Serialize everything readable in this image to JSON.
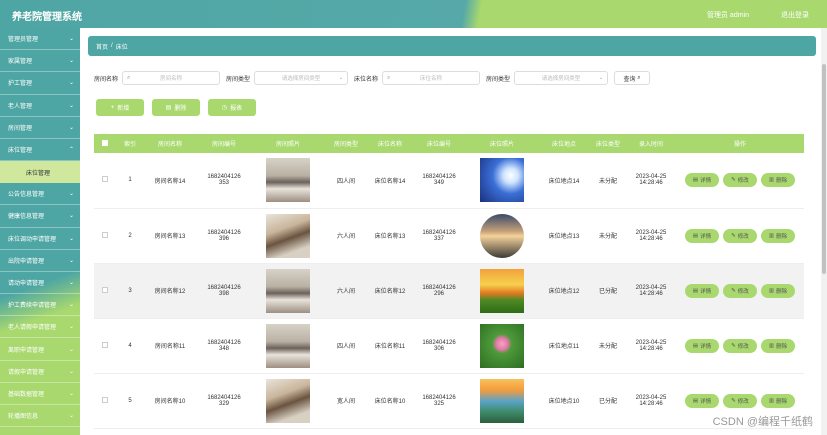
{
  "header": {
    "title": "养老院管理系统",
    "user": "管理员 admin",
    "logout": "退出登录"
  },
  "sidebar": {
    "items": [
      {
        "label": "管理员管理"
      },
      {
        "label": "家属管理"
      },
      {
        "label": "护工管理"
      },
      {
        "label": "老人管理"
      },
      {
        "label": "房间管理"
      },
      {
        "label": "床位管理"
      }
    ],
    "sub": {
      "label": "床位管理"
    },
    "items2": [
      {
        "label": "公告信息管理"
      },
      {
        "label": "健康信息管理"
      },
      {
        "label": "床位调动申请管理"
      },
      {
        "label": "出院申请管理"
      },
      {
        "label": "请动申请管理"
      },
      {
        "label": "护工费续申请管理"
      },
      {
        "label": "老人请假申请管理"
      },
      {
        "label": "离职申请管理"
      },
      {
        "label": "请假申请管理"
      },
      {
        "label": "基础数据管理"
      },
      {
        "label": "轮播图信息"
      }
    ]
  },
  "breadcrumb": {
    "home": "首页",
    "current": "床位"
  },
  "search": {
    "room_name_label": "房间名称",
    "room_name_placeholder": "房间名称",
    "room_type_label": "房间类型",
    "room_type_placeholder": "请选择房间类型",
    "bed_name_label": "床位名称",
    "bed_name_placeholder": "床位名称",
    "bed_type_label": "房间类型",
    "bed_type_placeholder": "请选择房间类型",
    "query_label": "查询"
  },
  "actions": {
    "add": "新增",
    "delete": "删除",
    "report": "报表"
  },
  "table": {
    "headers": [
      "索引",
      "房间名称",
      "房间编号",
      "房间照片",
      "房间类型",
      "床位名称",
      "床位编号",
      "床位照片",
      "床位地点",
      "床位类型",
      "录入时间",
      "操作"
    ],
    "rows": [
      {
        "index": "1",
        "room_name": "房间名称14",
        "room_no_a": "1682404126",
        "room_no_b": "353",
        "room_type": "四人间",
        "bed_name": "床位名称14",
        "bed_no_a": "1682404126",
        "bed_no_b": "349",
        "bed_place": "床位地点14",
        "bed_type": "未分配",
        "date": "2023-04-25",
        "time": "14:28:46"
      },
      {
        "index": "2",
        "room_name": "房间名称13",
        "room_no_a": "1682404126",
        "room_no_b": "396",
        "room_type": "六人间",
        "bed_name": "床位名称13",
        "bed_no_a": "1682404126",
        "bed_no_b": "337",
        "bed_place": "床位地点13",
        "bed_type": "未分配",
        "date": "2023-04-25",
        "time": "14:28:46"
      },
      {
        "index": "3",
        "room_name": "房间名称12",
        "room_no_a": "1682404126",
        "room_no_b": "398",
        "room_type": "六人间",
        "bed_name": "床位名称12",
        "bed_no_a": "1682404126",
        "bed_no_b": "296",
        "bed_place": "床位地点12",
        "bed_type": "已分配",
        "date": "2023-04-25",
        "time": "14:28:46"
      },
      {
        "index": "4",
        "room_name": "房间名称11",
        "room_no_a": "1682404126",
        "room_no_b": "348",
        "room_type": "四人间",
        "bed_name": "床位名称11",
        "bed_no_a": "1682404126",
        "bed_no_b": "306",
        "bed_place": "床位地点11",
        "bed_type": "未分配",
        "date": "2023-04-25",
        "time": "14:28:46"
      },
      {
        "index": "5",
        "room_name": "房间名称10",
        "room_no_a": "1682404126",
        "room_no_b": "329",
        "room_type": "宽人间",
        "bed_name": "床位名称10",
        "bed_no_a": "1682404126",
        "bed_no_b": "325",
        "bed_place": "床位地点10",
        "bed_type": "已分配",
        "date": "2023-04-25",
        "time": "14:28:46"
      }
    ],
    "ops": {
      "detail": "详情",
      "edit": "修改",
      "delete": "删除"
    }
  },
  "watermark": "CSDN @编程千纸鹤"
}
